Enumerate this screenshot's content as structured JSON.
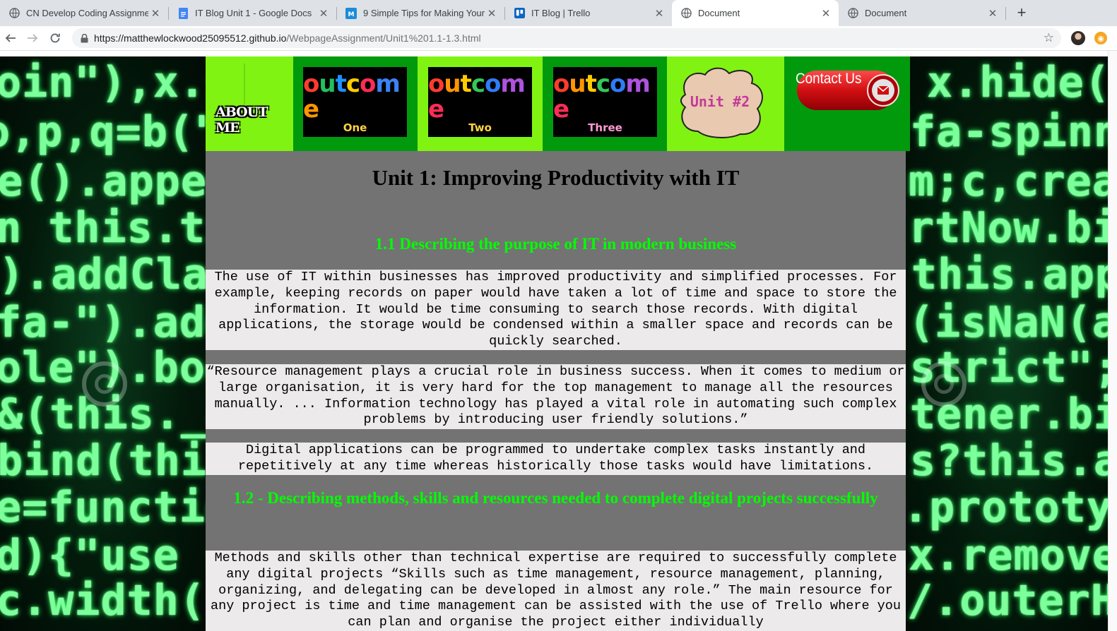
{
  "browser": {
    "tabs": [
      {
        "title": "CN Develop Coding Assignmen",
        "icon": "globe-icon",
        "active": false
      },
      {
        "title": "IT Blog Unit 1 - Google Docs",
        "icon": "google-docs-icon",
        "active": false
      },
      {
        "title": "9 Simple Tips for Making Your",
        "icon": "medium-icon",
        "active": false
      },
      {
        "title": "IT Blog | Trello",
        "icon": "trello-icon",
        "active": false
      },
      {
        "title": "Document",
        "icon": "globe-icon",
        "active": true
      },
      {
        "title": "Document",
        "icon": "globe-icon",
        "active": false
      }
    ],
    "url_host": "https://matthewlockwood25095512.github.io",
    "url_path": "/WebpageAssignment/Unit1%201.1-1.3.html"
  },
  "nav": {
    "about_label": "ABOUT ME",
    "outcome_word": "outcome",
    "outcome_letters": [
      "o",
      "u",
      "t",
      "c",
      "o",
      "m",
      "e"
    ],
    "outcome_colors_one": [
      "#ff3b30",
      "#22c05c",
      "#1e90ff",
      "#ffcc00",
      "#ff2d55",
      "#3b82f6",
      "#ff9500"
    ],
    "outcome_colors_two": [
      "#ff3b30",
      "#ff9500",
      "#ffcc00",
      "#34c759",
      "#2f7cf6",
      "#af52de",
      "#ff2d55"
    ],
    "outcome_colors_three": [
      "#ff3b30",
      "#ff9500",
      "#ffcc00",
      "#34c759",
      "#2f7cf6",
      "#af52de",
      "#ff2d55"
    ],
    "outcome_one_sub": "One",
    "outcome_two_sub": "Two",
    "outcome_three_sub": "Three",
    "unit2_label": "Unit #2",
    "contact_label": "Contact Us"
  },
  "page": {
    "title": "Unit 1: Improving Productivity with IT",
    "section1_heading": "1.1 Describing the purpose of IT in modern business",
    "para1": "The use of IT within businesses has improved productivity and simplified processes. For example, keeping records on paper would have taken a lot of time and space to store the information. It would be time consuming to search those records. With digital applications, the storage would be condensed within a smaller space and records can be quickly searched.",
    "para2": "“Resource management plays a crucial role in business success. When it comes to medium or large organisation, it is very hard for the top management to manage all the resources manually. ... Information technology has played a vital role in automating such complex problems by introducing user friendly solutions.”",
    "para3": "Digital applications can be programmed to undertake complex tasks instantly and repetitively at any time whereas historically those tasks would have limitations.",
    "section2_heading": "1.2 - Describing methods, skills and resources needed to complete digital projects successfully",
    "para4": "Methods and skills other than technical expertise are required to successfully complete any digital projects “Skills such as time management, resource management, planning, organizing, and delegating can be developed in almost any role.” The main resource for any project is time and time management can be assisted with the use of Trello where you can plan and organise the project either individually"
  },
  "background": {
    "left_lines": [
      "oin\"),x.s",
      "o,p,q=b(\"",
      "e().apper",
      "n this.ti",
      ").addClas",
      "fa-\").add",
      "ole\").boo",
      "&(this._a",
      "bind(this",
      "e=functio",
      "d){\"use s",
      "c.width("
    ],
    "right_lines": [
      "x.hide(",
      "fa-spinne",
      "m;c,creat",
      "rtNow.bin",
      "this.appe",
      "(isNaN(a",
      "strict\";f",
      "tener.bin",
      "s?this.an",
      ".prototyp",
      "x.remove(",
      "/.outerHe"
    ]
  },
  "colors": {
    "nav_lime": "#80f313",
    "nav_green": "#019a0d",
    "content_gray": "#737373",
    "para_bg": "#eceaea",
    "heading_green": "#00ff00"
  }
}
